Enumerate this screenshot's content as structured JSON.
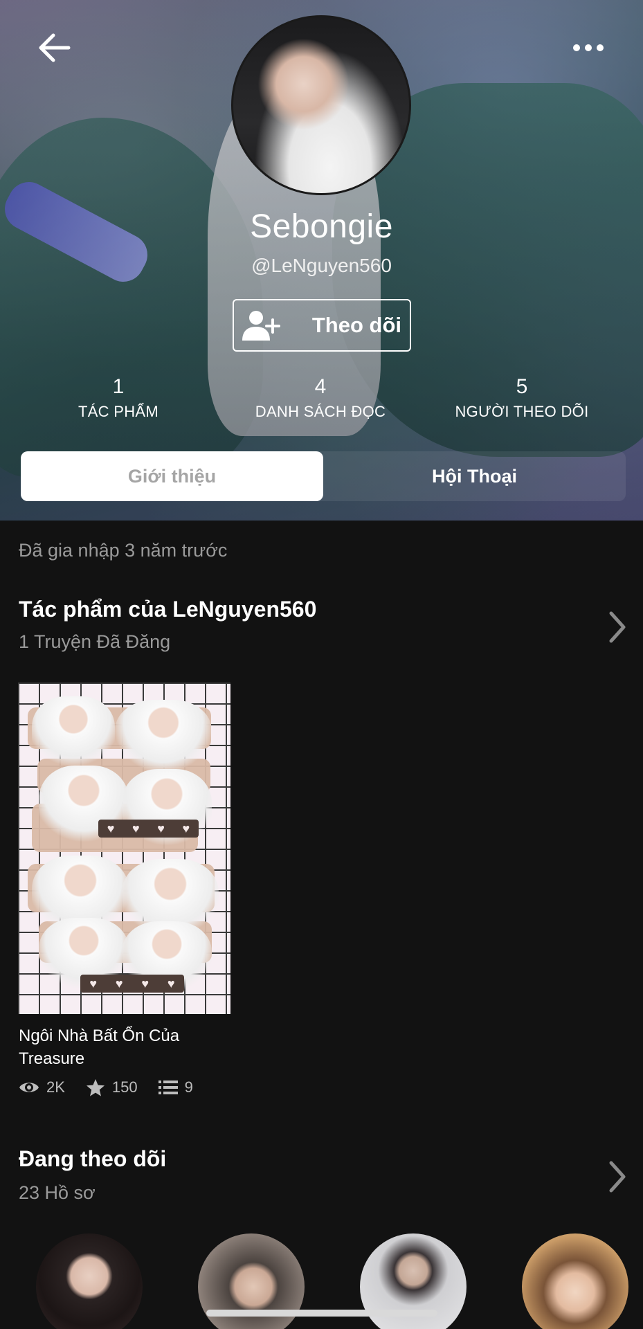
{
  "profile": {
    "display_name": "Sebongie",
    "username": "@LeNguyen560",
    "follow_label": "Theo dõi"
  },
  "stats": [
    {
      "value": "1",
      "label": "TÁC PHẨM"
    },
    {
      "value": "4",
      "label": "DANH SÁCH ĐỌC"
    },
    {
      "value": "5",
      "label": "NGƯỜI THEO DÕI"
    }
  ],
  "tabs": {
    "about": "Giới thiệu",
    "conversations": "Hội Thoại"
  },
  "joined": "Đã gia nhập 3 năm trước",
  "works": {
    "title": "Tác phẩm của LeNguyen560",
    "subtitle": "1 Truyện Đã Đăng",
    "story": {
      "title": "Ngôi Nhà Bất Ổn Của Treasure",
      "views": "2K",
      "votes": "150",
      "parts": "9"
    }
  },
  "following": {
    "title": "Đang theo dõi",
    "subtitle": "23 Hồ sơ"
  },
  "icons": {
    "back": "arrow-left-icon",
    "more": "more-horizontal-icon",
    "follow": "add-user-icon",
    "views": "eye-icon",
    "votes": "star-icon",
    "parts": "list-icon",
    "chevron": "chevron-right-icon"
  },
  "colors": {
    "background": "#121212",
    "muted_text": "#9a9a9a",
    "tab_active_bg": "#ffffff"
  }
}
